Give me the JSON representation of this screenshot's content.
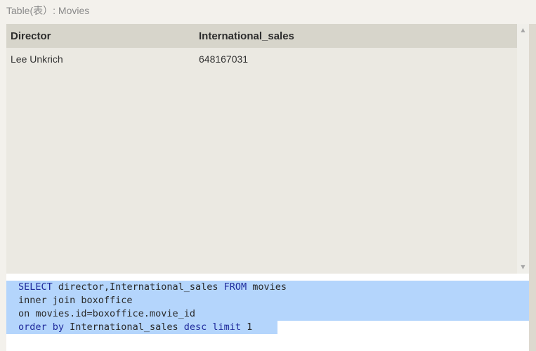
{
  "table_caption": {
    "prefix": "Table(",
    "cjk": "表",
    "suffix": "）: Movies"
  },
  "result": {
    "columns": [
      "Director",
      "International_sales"
    ],
    "rows": [
      [
        "Lee Unkrich",
        "648167031"
      ]
    ]
  },
  "scrollbar": {
    "up_arrow": "▲",
    "down_arrow": "▼"
  },
  "editor": {
    "lines": [
      [
        {
          "t": "SELECT",
          "k": true
        },
        {
          "t": " director,International_sales ",
          "k": false
        },
        {
          "t": "FROM",
          "k": true
        },
        {
          "t": " movies",
          "k": false
        }
      ],
      [
        {
          "t": "inner join boxoffice",
          "k": false
        }
      ],
      [
        {
          "t": "on movies.id=boxoffice.movie_id",
          "k": false
        }
      ],
      [
        {
          "t": "order by",
          "k": true
        },
        {
          "t": " International_sales ",
          "k": false
        },
        {
          "t": "desc limit",
          "k": true
        },
        {
          "t": " 1",
          "k": false
        }
      ]
    ],
    "selection_color": "#b4d5fc",
    "keyword_color": "#1f2b9c"
  }
}
